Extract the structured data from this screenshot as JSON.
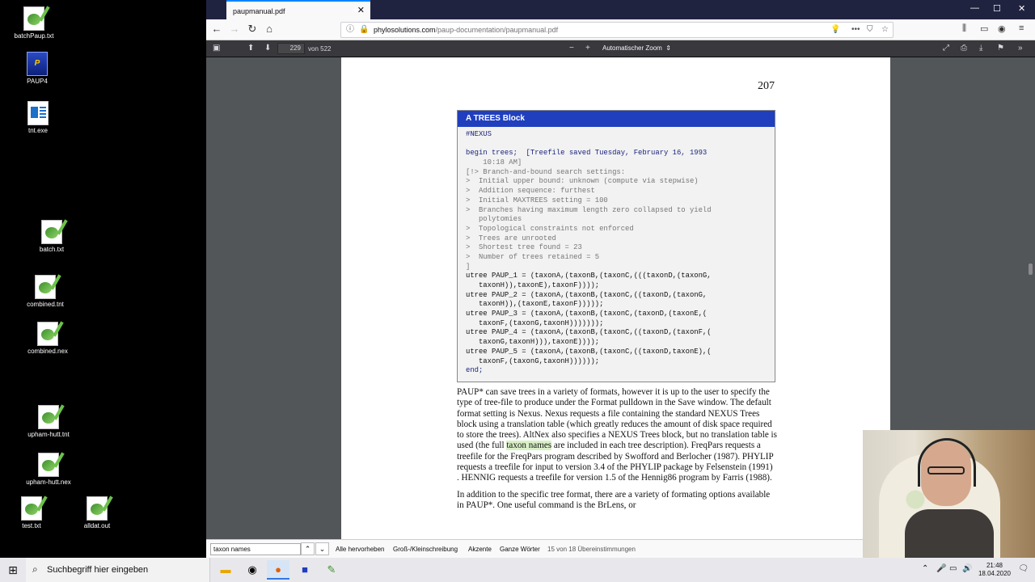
{
  "desktop": {
    "icons": [
      {
        "label": "batchPaup.txt",
        "icon": "notepad-frog-icon"
      },
      {
        "label": "PAUP4",
        "icon": "paup-app-icon"
      },
      {
        "label": "tnt.exe",
        "icon": "tnt-app-icon"
      },
      {
        "label": "batch.txt",
        "icon": "notepad-frog-icon"
      },
      {
        "label": "combined.tnt",
        "icon": "notepad-frog-icon"
      },
      {
        "label": "combined.nex",
        "icon": "notepad-frog-icon"
      },
      {
        "label": "upham-hutt.tnt",
        "icon": "notepad-frog-icon"
      },
      {
        "label": "upham-hutt.nex",
        "icon": "notepad-frog-icon"
      },
      {
        "label": "test.txt",
        "icon": "notepad-frog-icon"
      },
      {
        "label": "alldat.out",
        "icon": "notepad-frog-icon"
      }
    ]
  },
  "browser": {
    "tab_title": "paupmanual.pdf",
    "url_host": "phylosolutions.com",
    "url_path": "/paup-documentation/paupmanual.pdf",
    "accent": "#0a84ff"
  },
  "pdf_toolbar": {
    "page_current": "229",
    "page_of": "von 522",
    "zoom": "Automatischer Zoom"
  },
  "pdf_page": {
    "page_number": "207",
    "box_title": "A TREES Block",
    "code_lines": [
      {
        "t": "#NEXUS",
        "c": "kw"
      },
      {
        "t": "",
        "c": "spacer"
      },
      {
        "t": "begin trees;  [Treefile saved Tuesday, February 16, 1993",
        "c": "kw"
      },
      {
        "t": "    10:18 AM]",
        "c": "cm"
      },
      {
        "t": "[!> Branch-and-bound search settings:",
        "c": "cm"
      },
      {
        "t": ">  Initial upper bound: unknown (compute via stepwise)",
        "c": "cm"
      },
      {
        "t": ">  Addition sequence: furthest",
        "c": "cm"
      },
      {
        "t": ">  Initial MAXTREES setting = 100",
        "c": "cm"
      },
      {
        "t": ">  Branches having maximum length zero collapsed to yield",
        "c": "cm"
      },
      {
        "t": "   polytomies",
        "c": "cm"
      },
      {
        "t": ">  Topological constraints not enforced",
        "c": "cm"
      },
      {
        "t": ">  Trees are unrooted",
        "c": "cm"
      },
      {
        "t": ">  Shortest tree found = 23",
        "c": "cm"
      },
      {
        "t": ">  Number of trees retained = 5",
        "c": "cm"
      },
      {
        "t": "]",
        "c": "cm"
      },
      {
        "t": "utree PAUP_1 = (taxonA,(taxonB,(taxonC,(((taxonD,(taxonG,",
        "c": "tx"
      },
      {
        "t": "   taxonH)),taxonE),taxonF))));",
        "c": "tx"
      },
      {
        "t": "utree PAUP_2 = (taxonA,(taxonB,(taxonC,((taxonD,(taxonG,",
        "c": "tx"
      },
      {
        "t": "   taxonH)),(taxonE,taxonF)))));",
        "c": "tx"
      },
      {
        "t": "utree PAUP_3 = (taxonA,(taxonB,(taxonC,(taxonD,(taxonE,(",
        "c": "tx"
      },
      {
        "t": "   taxonF,(taxonG,taxonH)))))));",
        "c": "tx"
      },
      {
        "t": "utree PAUP_4 = (taxonA,(taxonB,(taxonC,((taxonD,(taxonF,(",
        "c": "tx"
      },
      {
        "t": "   taxonG,taxonH))),taxonE))));",
        "c": "tx"
      },
      {
        "t": "utree PAUP_5 = (taxonA,(taxonB,(taxonC,((taxonD,taxonE),(",
        "c": "tx"
      },
      {
        "t": "   taxonF,(taxonG,taxonH))))));",
        "c": "tx"
      },
      {
        "t": "end;",
        "c": "kw"
      }
    ],
    "para1_before": "PAUP* can save trees in a variety of formats, however it is up to the user to specify the type of tree-file to produce under the Format pulldown in the Save window. The default format setting is Nexus. Nexus requests a file containing the standard NEXUS Trees block using a translation table (which greatly reduces the amount of disk space required to store the trees). AltNex also specifies a NEXUS Trees block, but no translation table is used (the full ",
    "para1_highlight": "taxon names",
    "para1_after": " are included in each tree description). FreqPars requests a treefile for the FreqPars program described by Swofford and Berlocher (1987). PHYLIP requests a treefile for input to version 3.4 of the PHYLIP package by Felsenstein (1991) . HENNIG requests a treefile for version 1.5 of the Hennig86 program by Farris (1988).",
    "para2": "In addition to the specific tree format, there are a variety of formating options available in PAUP*. One useful command is the BrLens, or"
  },
  "findbar": {
    "query": "taxon names",
    "highlight_all": "Alle hervorheben",
    "match_case": "Groß-/Kleinschreibung",
    "diacritics": "Akzente",
    "whole_words": "Ganze Wörter",
    "status": "15 von 18 Übereinstimmungen"
  },
  "taskbar": {
    "search_placeholder": "Suchbegriff hier eingeben",
    "time": "21:48",
    "date": "18.04.2020"
  }
}
